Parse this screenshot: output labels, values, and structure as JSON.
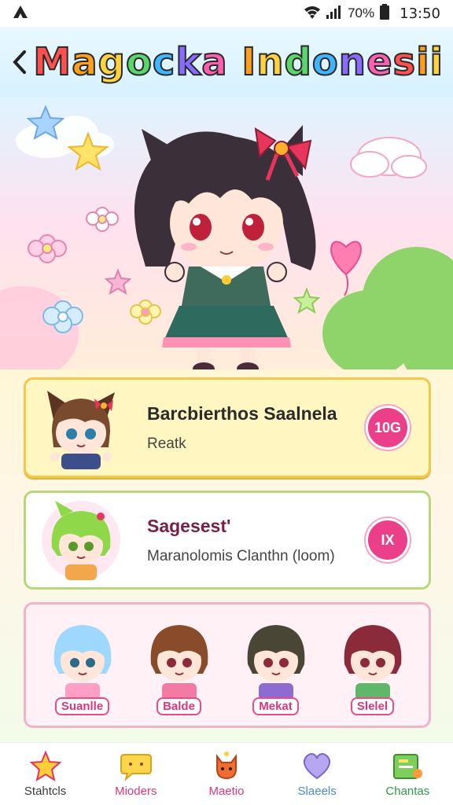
{
  "status_bar": {
    "battery": "70%",
    "time": "13:50"
  },
  "header": {
    "title": "Magocka Indonesii"
  },
  "cards": [
    {
      "title": "Barcbierthos Saalnela",
      "subtitle": "Reatk",
      "badge": "10G"
    },
    {
      "title": "Sagesest'",
      "subtitle": "Maranolomis Clanthn (loom)",
      "badge": "IX"
    }
  ],
  "friends": [
    {
      "name": "Suanlle",
      "hair": "#9fd8ff"
    },
    {
      "name": "Balde",
      "hair": "#8a4b2a"
    },
    {
      "name": "Mekat",
      "hair": "#4a4636"
    },
    {
      "name": "Slelel",
      "hair": "#8a2a3a"
    }
  ],
  "nav": [
    {
      "label": "Stahtcls",
      "color": "#3a3a3a",
      "icon": "star-icon"
    },
    {
      "label": "Mioders",
      "color": "#e0357c",
      "icon": "chat-bubble-icon"
    },
    {
      "label": "Maetio",
      "color": "#e0357c",
      "icon": "fox-icon"
    },
    {
      "label": "Slaeels",
      "color": "#4a8ac8",
      "icon": "heart-icon"
    },
    {
      "label": "Chantas",
      "color": "#2f9a48",
      "icon": "folder-icon"
    }
  ],
  "colors": {
    "accent": "#ec3f8a",
    "card1_border": "#f2c94c",
    "card2_border": "#b6d77a",
    "card3_border": "#f1b3c8"
  }
}
